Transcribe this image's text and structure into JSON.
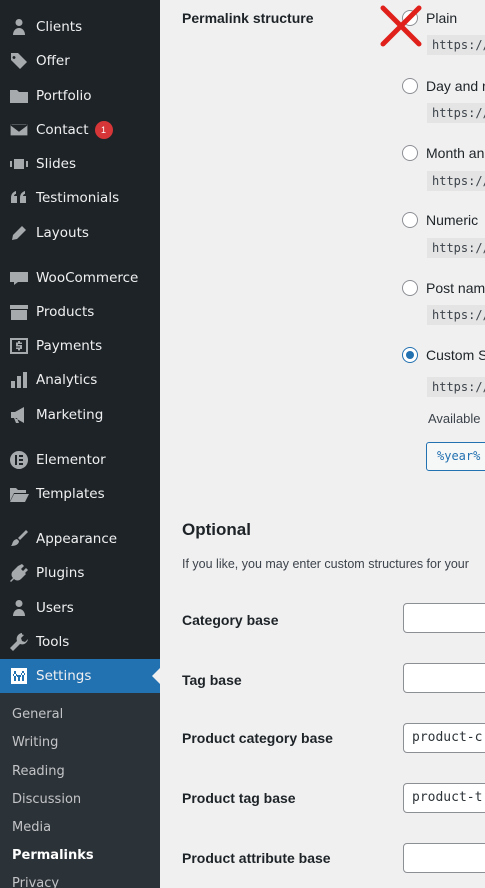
{
  "sidebar": {
    "items": [
      {
        "label": "Clients",
        "icon": "user-icon"
      },
      {
        "label": "Offer",
        "icon": "tag-icon"
      },
      {
        "label": "Portfolio",
        "icon": "folder-icon"
      },
      {
        "label": "Contact",
        "icon": "envelope-icon",
        "badge": "1"
      },
      {
        "label": "Slides",
        "icon": "slides-icon"
      },
      {
        "label": "Testimonials",
        "icon": "quote-icon"
      },
      {
        "label": "Layouts",
        "icon": "pencil-icon"
      },
      {
        "label": "WooCommerce",
        "icon": "woo-icon"
      },
      {
        "label": "Products",
        "icon": "archive-icon"
      },
      {
        "label": "Payments",
        "icon": "dollar-icon"
      },
      {
        "label": "Analytics",
        "icon": "bar-chart-icon"
      },
      {
        "label": "Marketing",
        "icon": "megaphone-icon"
      },
      {
        "label": "Elementor",
        "icon": "elementor-icon"
      },
      {
        "label": "Templates",
        "icon": "folder-open-icon"
      },
      {
        "label": "Appearance",
        "icon": "paintbrush-icon"
      },
      {
        "label": "Plugins",
        "icon": "plug-icon"
      },
      {
        "label": "Users",
        "icon": "users-icon"
      },
      {
        "label": "Tools",
        "icon": "wrench-icon"
      },
      {
        "label": "Settings",
        "icon": "settings-icon"
      }
    ],
    "submenu": [
      "General",
      "Writing",
      "Reading",
      "Discussion",
      "Media",
      "Permalinks",
      "Privacy"
    ],
    "current_submenu": "Permalinks"
  },
  "permalink": {
    "label": "Permalink structure",
    "options": [
      {
        "label": "Plain",
        "sample": "https://"
      },
      {
        "label": "Day and n",
        "sample": "https://"
      },
      {
        "label": "Month an",
        "sample": "https://"
      },
      {
        "label": "Numeric",
        "sample": "https://"
      },
      {
        "label": "Post nam",
        "sample": "https://"
      },
      {
        "label": "Custom S",
        "sample": "https://",
        "checked": true
      }
    ],
    "available_label": "Available",
    "tag_button": "%year%"
  },
  "optional": {
    "title": "Optional",
    "description": "If you like, you may enter custom structures for your",
    "fields": [
      {
        "label": "Category base",
        "value": ""
      },
      {
        "label": "Tag base",
        "value": ""
      },
      {
        "label": "Product category base",
        "value": "product-c"
      },
      {
        "label": "Product tag base",
        "value": "product-t"
      },
      {
        "label": "Product attribute base",
        "value": ""
      }
    ]
  },
  "colors": {
    "accent": "#2271b1",
    "sidebar": "#1d2327",
    "badge": "#d63638",
    "annotation": "#e0201a"
  }
}
